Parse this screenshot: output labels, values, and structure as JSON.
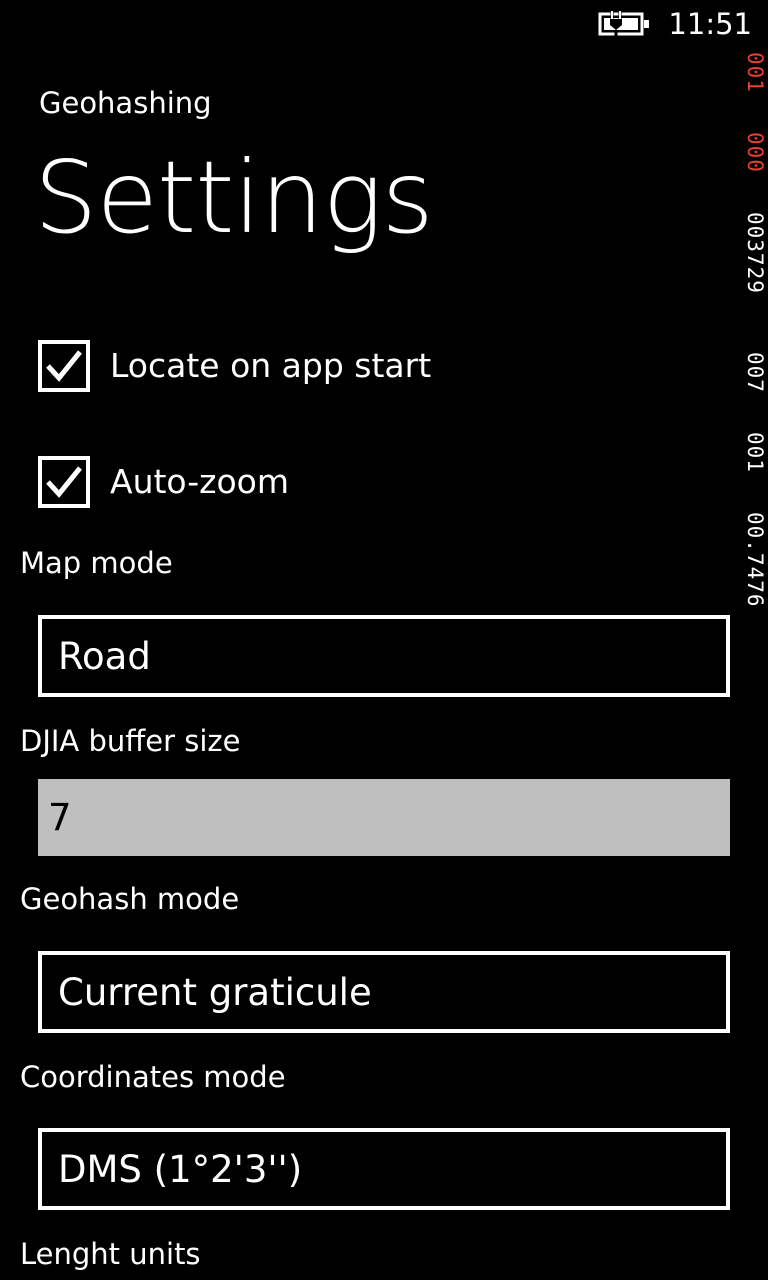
{
  "status_bar": {
    "battery_icon": "battery-charging-icon",
    "time": "11:51"
  },
  "debug_counters": {
    "values": [
      "001",
      "000",
      "003729",
      "007",
      "001",
      "00.7476"
    ],
    "colors": [
      "#e8412c",
      "#e8412c",
      "#ffffff",
      "#ffffff",
      "#ffffff",
      "#ffffff"
    ]
  },
  "header": {
    "app_title": "Geohashing",
    "page_title": "Settings"
  },
  "settings": {
    "locate_on_start": {
      "label": "Locate on app start",
      "checked": true,
      "icon": "checkmark-icon"
    },
    "auto_zoom": {
      "label": "Auto-zoom",
      "checked": true,
      "icon": "checkmark-icon"
    },
    "map_mode": {
      "label": "Map mode",
      "value": "Road"
    },
    "djia_buffer": {
      "label": "DJIA buffer size",
      "value": "7"
    },
    "geohash_mode": {
      "label": "Geohash mode",
      "value": "Current graticule"
    },
    "coordinates_mode": {
      "label": "Coordinates mode",
      "value": "DMS (1°2'3'')"
    },
    "length_units": {
      "label": "Lenght units"
    }
  },
  "colors": {
    "background": "#000000",
    "foreground": "#ffffff",
    "textbox_background": "#bfbfbf",
    "counter_accent": "#e8412c"
  }
}
